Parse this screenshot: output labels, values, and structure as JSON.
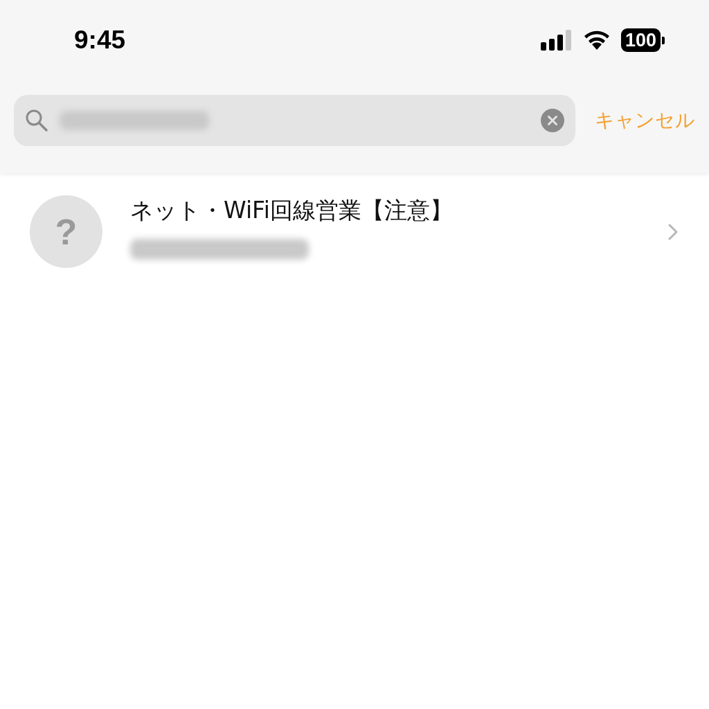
{
  "status_bar": {
    "time": "9:45",
    "battery": "100"
  },
  "search": {
    "cancel": "キャンセル"
  },
  "results": [
    {
      "avatar": "?",
      "title": "ネット・WiFi回線営業【注意】"
    }
  ]
}
